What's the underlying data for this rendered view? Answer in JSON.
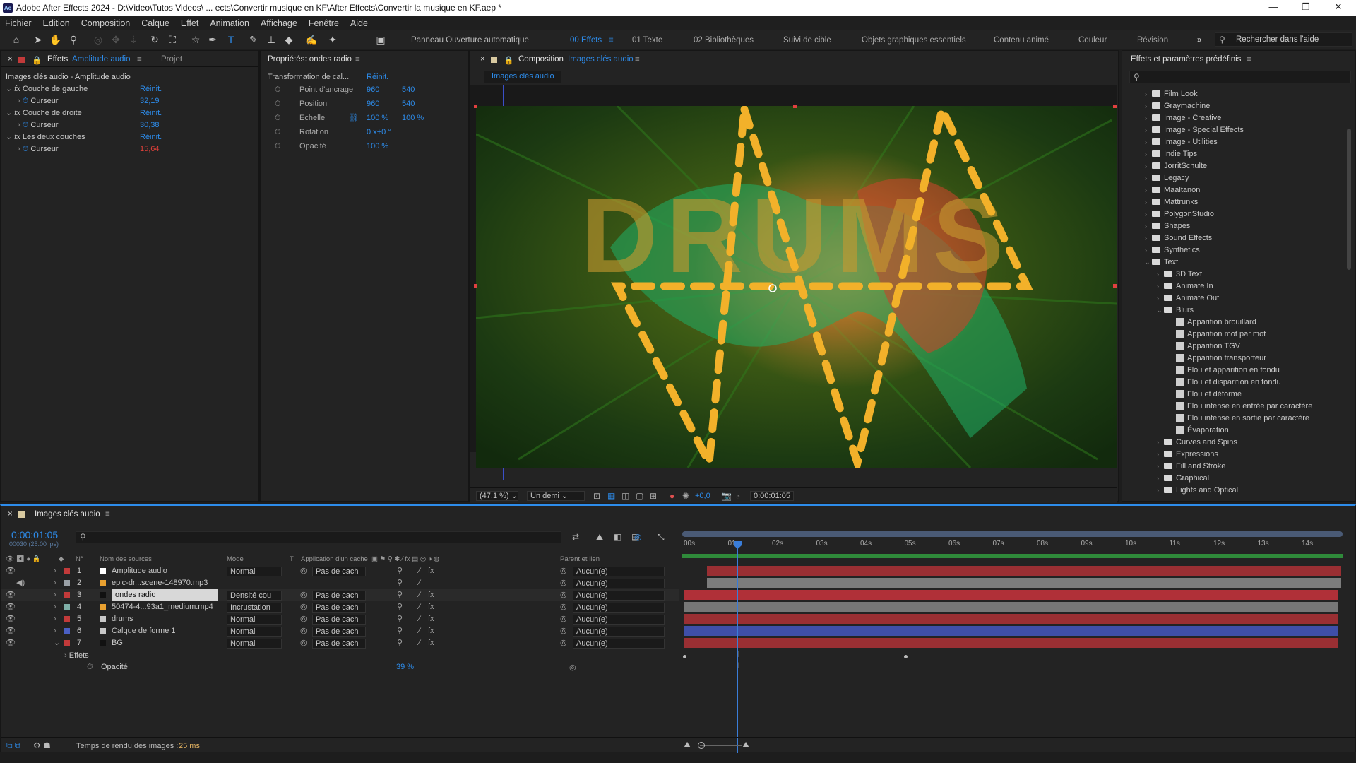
{
  "app": {
    "title": "Adobe After Effects 2024 - D:\\Video\\Tutos Videos\\ ... ects\\Convertir musique en KF\\After Effects\\Convertir la musique en KF.aep *",
    "logo": "Ae"
  },
  "menu": [
    "Fichier",
    "Edition",
    "Composition",
    "Calque",
    "Effet",
    "Animation",
    "Affichage",
    "Fenêtre",
    "Aide"
  ],
  "toolbar": {
    "auto_open": "Panneau Ouverture automatique",
    "workspaces": [
      "00 Effets",
      "01 Texte",
      "02 Bibliothèques",
      "Suivi de cible",
      "Objets graphiques essentiels",
      "Contenu animé",
      "Couleur",
      "Révision"
    ],
    "search": "Rechercher dans l'aide"
  },
  "effects_panel": {
    "tab_prefix": "Effets",
    "tab_layer": "Amplitude audio",
    "tab_project": "Projet",
    "heading": "Images clés audio - Amplitude audio",
    "reset": "Réinit.",
    "cursor": "Curseur",
    "groups": [
      {
        "name": "Couche de gauche",
        "value": "32,19"
      },
      {
        "name": "Couche de droite",
        "value": "30,38"
      },
      {
        "name": "Les deux couches",
        "value": "15,64"
      }
    ]
  },
  "props_panel": {
    "title": "Propriétés: ondes radio",
    "section": "Transformation de cal...",
    "reset": "Réinit.",
    "props": [
      {
        "label": "Point d'ancrage",
        "v1": "960",
        "v2": "540"
      },
      {
        "label": "Position",
        "v1": "960",
        "v2": "540"
      },
      {
        "label": "Echelle",
        "v1": "100 %",
        "v2": "100 %"
      },
      {
        "label": "Rotation",
        "v1": "0 x+0 °",
        "v2": ""
      },
      {
        "label": "Opacité",
        "v1": "100 %",
        "v2": ""
      }
    ]
  },
  "comp_panel": {
    "label": "Composition",
    "name": "Images clés audio",
    "tab": "Images clés audio",
    "zoom": "(47,1 %)",
    "res": "Un demi",
    "exposure": "+0,0",
    "time": "0:00:01:05",
    "preview_text": "DRUMS"
  },
  "presets_panel": {
    "title": "Effets et paramètres prédéfinis",
    "items": [
      {
        "d": 2,
        "t": "f",
        "label": "Film Look"
      },
      {
        "d": 2,
        "t": "f",
        "label": "Graymachine"
      },
      {
        "d": 2,
        "t": "f",
        "label": "Image - Creative"
      },
      {
        "d": 2,
        "t": "f",
        "label": "Image - Special Effects"
      },
      {
        "d": 2,
        "t": "f",
        "label": "Image - Utilities"
      },
      {
        "d": 2,
        "t": "f",
        "label": "Indie Tips"
      },
      {
        "d": 2,
        "t": "f",
        "label": "JorritSchulte"
      },
      {
        "d": 2,
        "t": "f",
        "label": "Legacy"
      },
      {
        "d": 2,
        "t": "f",
        "label": "Maaltanon"
      },
      {
        "d": 2,
        "t": "f",
        "label": "Mattrunks"
      },
      {
        "d": 2,
        "t": "f",
        "label": "PolygonStudio"
      },
      {
        "d": 2,
        "t": "f",
        "label": "Shapes"
      },
      {
        "d": 2,
        "t": "f",
        "label": "Sound Effects"
      },
      {
        "d": 2,
        "t": "f",
        "label": "Synthetics"
      },
      {
        "d": 2,
        "t": "o",
        "label": "Text"
      },
      {
        "d": 3,
        "t": "f",
        "label": "3D Text"
      },
      {
        "d": 3,
        "t": "f",
        "label": "Animate In"
      },
      {
        "d": 3,
        "t": "f",
        "label": "Animate Out"
      },
      {
        "d": 3,
        "t": "o",
        "label": "Blurs"
      },
      {
        "d": 4,
        "t": "p",
        "label": "Apparition brouillard"
      },
      {
        "d": 4,
        "t": "p",
        "label": "Apparition mot par mot"
      },
      {
        "d": 4,
        "t": "p",
        "label": "Apparition TGV"
      },
      {
        "d": 4,
        "t": "p",
        "label": "Apparition transporteur"
      },
      {
        "d": 4,
        "t": "p",
        "label": "Flou et apparition en fondu"
      },
      {
        "d": 4,
        "t": "p",
        "label": "Flou et disparition en fondu"
      },
      {
        "d": 4,
        "t": "p",
        "label": "Flou et déformé"
      },
      {
        "d": 4,
        "t": "p",
        "label": "Flou intense en entrée par caractère"
      },
      {
        "d": 4,
        "t": "p",
        "label": "Flou intense en sortie par caractère"
      },
      {
        "d": 4,
        "t": "p",
        "label": "Évaporation"
      },
      {
        "d": 3,
        "t": "f",
        "label": "Curves and Spins"
      },
      {
        "d": 3,
        "t": "f",
        "label": "Expressions"
      },
      {
        "d": 3,
        "t": "f",
        "label": "Fill and Stroke"
      },
      {
        "d": 3,
        "t": "f",
        "label": "Graphical"
      },
      {
        "d": 3,
        "t": "f",
        "label": "Lights and Optical"
      }
    ]
  },
  "timeline": {
    "comp": "Images clés audio",
    "time": "0:00:01:05",
    "frames": "00030 (25.00 ips)",
    "headers": {
      "num": "N°",
      "source": "Nom des sources",
      "mode": "Mode",
      "t": "T",
      "matte": "Application d'un cache",
      "parent": "Parent et lien"
    },
    "layers": [
      {
        "n": "1",
        "name": "Amplitude audio",
        "mode": "Normal",
        "matte": "Pas de cach",
        "parent": "Aucun(e)",
        "color": "#c23a3a",
        "icon": "#ffffff",
        "bar": "#9a2f33"
      },
      {
        "n": "2",
        "name": "epic-dr...scene-148970.mp3",
        "mode": "",
        "matte": "",
        "parent": "Aucun(e)",
        "color": "#9aa0a6",
        "icon": "#e8a030",
        "bar": "#7c7c7c"
      },
      {
        "n": "3",
        "name": "ondes radio",
        "mode": "Densité cou",
        "matte": "Pas de cach",
        "parent": "Aucun(e)",
        "color": "#c23a3a",
        "icon": "#111111",
        "bar": "#b03038"
      },
      {
        "n": "4",
        "name": "50474-4...93a1_medium.mp4",
        "mode": "Incrustation",
        "matte": "Pas de cach",
        "parent": "Aucun(e)",
        "color": "#7fb0a8",
        "icon": "#e8a030",
        "bar": "#777777"
      },
      {
        "n": "5",
        "name": "drums",
        "mode": "Normal",
        "matte": "Pas de cach",
        "parent": "Aucun(e)",
        "color": "#c23a3a",
        "icon": "#c8c8c8",
        "bar": "#9a2f33"
      },
      {
        "n": "6",
        "name": "Calque de forme 1",
        "mode": "Normal",
        "matte": "Pas de cach",
        "parent": "Aucun(e)",
        "color": "#4a5fc4",
        "icon": "#c8c8c8",
        "bar": "#3f4fa8"
      },
      {
        "n": "7",
        "name": "BG",
        "mode": "Normal",
        "matte": "Pas de cach",
        "parent": "Aucun(e)",
        "color": "#c23a3a",
        "icon": "#111111",
        "bar": "#9a2f33"
      }
    ],
    "sub": {
      "effects": "Effets",
      "opacity": "Opacité",
      "opacity_value": "39 %"
    },
    "ruler": [
      "00s",
      "01s",
      "02s",
      "03s",
      "04s",
      "05s",
      "06s",
      "07s",
      "08s",
      "09s",
      "10s",
      "11s",
      "12s",
      "13s",
      "14s"
    ],
    "status": "Temps de rendu des images :",
    "render_time": "25 ms"
  }
}
